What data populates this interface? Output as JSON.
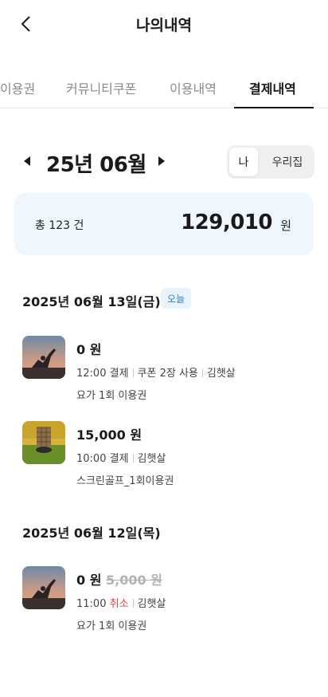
{
  "header": {
    "title": "나의내역",
    "back_icon": "chevron-left-icon"
  },
  "tabs": [
    {
      "label": "이용권",
      "active": false
    },
    {
      "label": "커뮤니티쿠폰",
      "active": false
    },
    {
      "label": "이용내역",
      "active": false
    },
    {
      "label": "결제내역",
      "active": true
    }
  ],
  "month": {
    "label": "25년 06월",
    "prev_icon": "triangle-left-icon",
    "next_icon": "triangle-right-icon"
  },
  "toggle": {
    "me": "나",
    "home": "우리집",
    "selected": "나"
  },
  "summary": {
    "count": "총 123 건",
    "amount": "129,010",
    "unit": "원"
  },
  "groups": [
    {
      "date": "2025년 06월 13일(금)",
      "badge": "오늘",
      "items": [
        {
          "thumb": "yoga",
          "amount": "0 원",
          "original": "",
          "time": "12:00",
          "status": "결제",
          "cancelled": false,
          "coupon": "쿠폰 2장 사용",
          "user": "김햇살",
          "desc": "요가 1회 이용권"
        },
        {
          "thumb": "golf",
          "amount": "15,000 원",
          "original": "",
          "time": "10:00",
          "status": "결제",
          "cancelled": false,
          "coupon": "",
          "user": "김햇살",
          "desc": "스크린골프_1회이용권"
        }
      ]
    },
    {
      "date": "2025년 06월 12일(목)",
      "badge": "",
      "items": [
        {
          "thumb": "yoga",
          "amount": "0 원",
          "original": "5,000 원",
          "time": "11:00",
          "status": "취소",
          "cancelled": true,
          "coupon": "",
          "user": "김햇살",
          "desc": "요가 1회 이용권"
        }
      ]
    }
  ],
  "colors": {
    "summary_bg": "#eff6fd",
    "badge_bg": "#e8f3fd",
    "badge_text": "#2a84c7",
    "cancel": "#e04646"
  }
}
